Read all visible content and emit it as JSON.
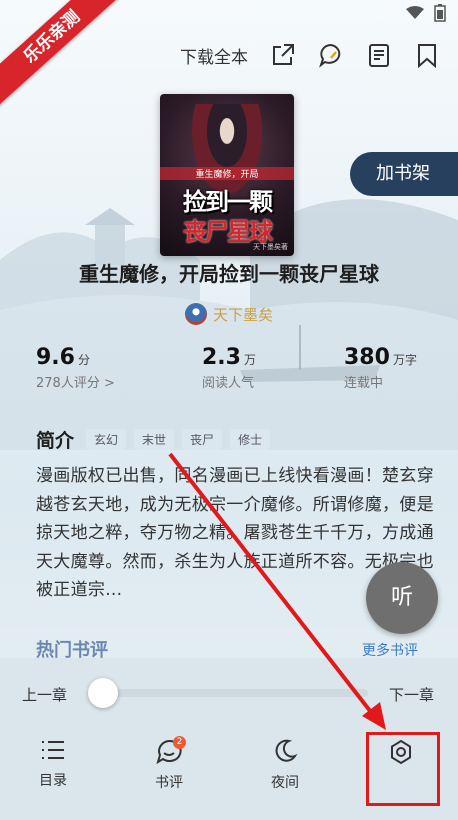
{
  "watermark": "乐乐亲测",
  "header": {
    "download_label": "下载全本",
    "icons": [
      "share-icon",
      "comment-icon",
      "detail-icon",
      "bookmark-icon"
    ]
  },
  "book": {
    "cover_top": "重生魔修，开局",
    "cover_title_1": "捡到一颗",
    "cover_title_2": "丧尸星球",
    "cover_author": "天下墨矣著",
    "title": "重生魔修，开局捡到一颗丧尸星球",
    "author": "天下墨矣"
  },
  "add_shelf_label": "加书架",
  "stats": [
    {
      "num": "9.6",
      "unit": "分",
      "label": "278人评分 >"
    },
    {
      "num": "2.3",
      "unit": "万",
      "label": "阅读人气"
    },
    {
      "num": "380",
      "unit": "万字",
      "label": "连载中"
    }
  ],
  "intro": {
    "title": "简介",
    "tags": [
      "玄幻",
      "末世",
      "丧尸",
      "修士"
    ],
    "text": "漫画版权已出售，同名漫画已上线快看漫画！楚玄穿越苍玄天地，成为无极宗一介魔修。所谓修魔，便是掠天地之粹，夺万物之精。屠戮苍生千千万，方成通天大魔尊。然而，杀生为人族正道所不容。无极宗也被正道宗..."
  },
  "listen_label": "听",
  "reviews": {
    "hot_label": "热门书评",
    "more_label": "更多书评"
  },
  "reader_panel": {
    "prev_label": "上一章",
    "next_label": "下一章",
    "progress": 0.0,
    "nav": [
      {
        "label": "目录",
        "icon": "menu-icon"
      },
      {
        "label": "书评",
        "icon": "comment-icon",
        "badge": "2"
      },
      {
        "label": "夜间",
        "icon": "moon-icon"
      },
      {
        "label": "",
        "icon": "settings-icon"
      }
    ]
  },
  "colors": {
    "accent_dark": "#27405e",
    "author_gold": "#c9a04a",
    "link_blue": "#3a7cc4",
    "annotation_red": "#e2191b"
  }
}
